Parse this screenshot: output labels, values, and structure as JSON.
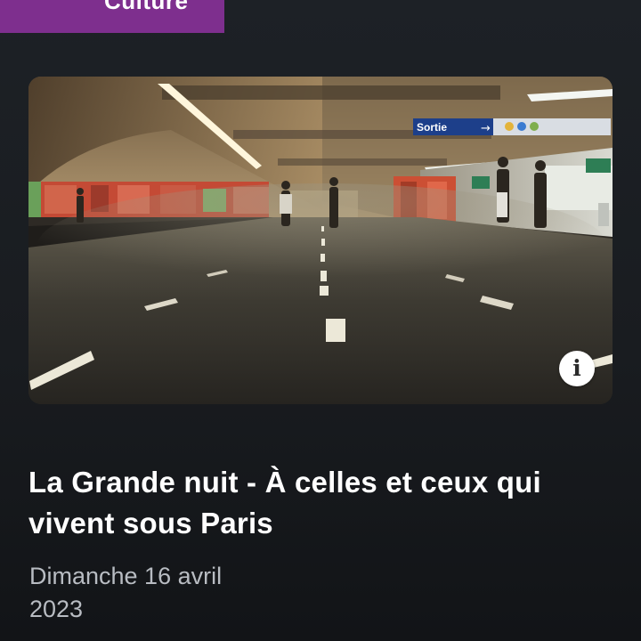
{
  "category": {
    "label": "Culture",
    "color": "#7e2f8e"
  },
  "article": {
    "title": "La Grande nuit - À celles et ceux qui vivent sous Paris",
    "date": "Dimanche 16 avril 2023"
  },
  "image": {
    "subject": "metro-station-platform-photo",
    "sign_text": "Sortie",
    "info_icon": "info-icon",
    "info_label": "i"
  },
  "colors": {
    "background": "#1b1e22",
    "title_text": "#ffffff",
    "date_text": "#b8bcc2",
    "info_button": "#ffffff"
  }
}
